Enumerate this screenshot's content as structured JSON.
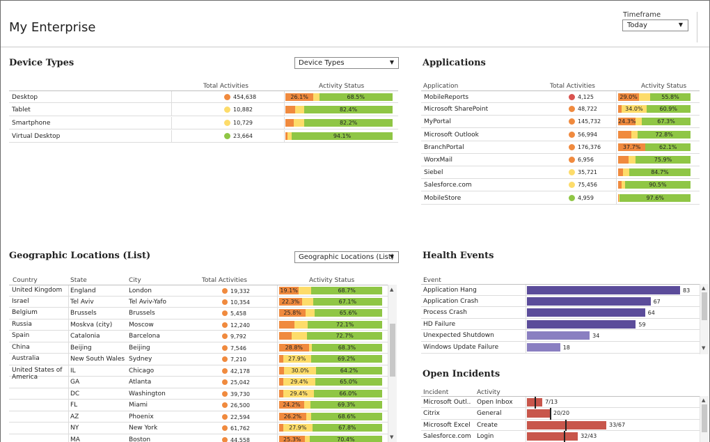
{
  "header": {
    "title": "My Enterprise",
    "timeframe_label": "Timeframe",
    "timeframe_value": "Today"
  },
  "colors": {
    "critical": "#f08a3e",
    "warning": "#fddc6a",
    "ok": "#8fc645",
    "dot_red": "#d9534f",
    "dot_orange": "#f08a3e",
    "dot_yellow": "#fddc6a",
    "dot_green": "#8fc645",
    "health_bar": "#5b4c9a",
    "incident_bar": "#c8564b"
  },
  "device_types": {
    "title": "Device Types",
    "dropdown": "Device Types",
    "col_total": "Total Activities",
    "col_status": "Activity Status",
    "rows": [
      {
        "name": "Desktop",
        "dot": "orange",
        "total": "454,638",
        "r": 26.1,
        "y": 5.4,
        "g": 68.5,
        "rl": "26.1%",
        "gl": "68.5%"
      },
      {
        "name": "Tablet",
        "dot": "yellow",
        "total": "10,882",
        "r": 9,
        "y": 8.6,
        "g": 82.4,
        "rl": "",
        "gl": "82.4%"
      },
      {
        "name": "Smartphone",
        "dot": "yellow",
        "total": "10,729",
        "r": 8,
        "y": 9.8,
        "g": 82.2,
        "rl": "",
        "gl": "82.2%"
      },
      {
        "name": "Virtual Desktop",
        "dot": "green",
        "total": "23,664",
        "r": 2,
        "y": 3.9,
        "g": 94.1,
        "rl": "",
        "gl": "94.1%"
      }
    ]
  },
  "applications": {
    "title": "Applications",
    "col_name": "Application",
    "col_total": "Total Activities",
    "col_status": "Activity Status",
    "rows": [
      {
        "name": "MobileReports",
        "dot": "red",
        "total": "4,125",
        "r": 29.0,
        "y": 15.2,
        "g": 55.8,
        "rl": "29.0%",
        "gl": "55.8%"
      },
      {
        "name": "Microsoft SharePoint",
        "dot": "orange",
        "total": "48,722",
        "r": 5,
        "y": 34.0,
        "g": 60.9,
        "rl": "",
        "yl": "34.0%",
        "gl": "60.9%"
      },
      {
        "name": "MyPortal",
        "dot": "orange",
        "total": "145,732",
        "r": 24.3,
        "y": 8.4,
        "g": 67.3,
        "rl": "24.3%",
        "gl": "67.3%"
      },
      {
        "name": "Microsoft Outlook",
        "dot": "orange",
        "total": "56,994",
        "r": 18,
        "y": 9.2,
        "g": 72.8,
        "rl": "",
        "gl": "72.8%"
      },
      {
        "name": "BranchPortal",
        "dot": "orange",
        "total": "176,376",
        "r": 37.7,
        "y": 0.2,
        "g": 62.1,
        "rl": "37.7%",
        "gl": "62.1%"
      },
      {
        "name": "WorxMail",
        "dot": "orange",
        "total": "6,956",
        "r": 14,
        "y": 10.1,
        "g": 75.9,
        "rl": "",
        "gl": "75.9%"
      },
      {
        "name": "Siebel",
        "dot": "yellow",
        "total": "35,721",
        "r": 7,
        "y": 8.3,
        "g": 84.7,
        "rl": "",
        "gl": "84.7%"
      },
      {
        "name": "Salesforce.com",
        "dot": "yellow",
        "total": "75,456",
        "r": 5,
        "y": 4.5,
        "g": 90.5,
        "rl": "",
        "gl": "90.5%"
      },
      {
        "name": "MobileStore",
        "dot": "green",
        "total": "4,959",
        "r": 1.4,
        "y": 1,
        "g": 97.6,
        "rl": "",
        "gl": "97.6%"
      }
    ]
  },
  "geo": {
    "title": "Geographic Locations (List)",
    "dropdown": "Geographic Locations (List)",
    "col_country": "Country",
    "col_state": "State",
    "col_city": "City",
    "col_total": "Total Activities",
    "col_status": "Activity Status",
    "rows": [
      {
        "country": "United Kingdom",
        "state": "England",
        "city": "London",
        "total": "19,332",
        "r": 19.1,
        "y": 12.2,
        "g": 68.7,
        "rl": "19.1%",
        "gl": "68.7%"
      },
      {
        "country": "Israel",
        "state": "Tel Aviv",
        "city": "Tel Aviv-Yafo",
        "total": "10,354",
        "r": 22.3,
        "y": 10.6,
        "g": 67.1,
        "rl": "22.3%",
        "gl": "67.1%"
      },
      {
        "country": "Belgium",
        "state": "Brussels",
        "city": "Brussels",
        "total": "5,458",
        "r": 25.8,
        "y": 8.6,
        "g": 65.6,
        "rl": "25.8%",
        "gl": "65.6%"
      },
      {
        "country": "Russia",
        "state": "Moskva (city)",
        "city": "Moscow",
        "total": "12,240",
        "r": 15,
        "y": 12.9,
        "g": 72.1,
        "rl": "",
        "gl": "72.1%"
      },
      {
        "country": "Spain",
        "state": "Catalonia",
        "city": "Barcelona",
        "total": "9,792",
        "r": 12,
        "y": 15.3,
        "g": 72.7,
        "rl": "",
        "gl": "72.7%"
      },
      {
        "country": "China",
        "state": "Beijing",
        "city": "Beijing",
        "total": "7,546",
        "r": 28.8,
        "y": 2.9,
        "g": 68.3,
        "rl": "28.8%",
        "gl": "68.3%"
      },
      {
        "country": "Australia",
        "state": "New South Wales",
        "city": "Sydney",
        "total": "7,210",
        "r": 4,
        "y": 26.8,
        "g": 69.2,
        "yl": "27.9%",
        "rl": "",
        "gl": "69.2%"
      },
      {
        "country": "United States of America",
        "state": "IL",
        "city": "Chicago",
        "total": "42,178",
        "r": 5,
        "y": 30.8,
        "g": 64.2,
        "yl": "30.0%",
        "rl": "",
        "gl": "64.2%"
      },
      {
        "country": "",
        "state": "GA",
        "city": "Atlanta",
        "total": "25,042",
        "r": 4,
        "y": 31.0,
        "g": 65.0,
        "yl": "29.4%",
        "rl": "",
        "gl": "65.0%"
      },
      {
        "country": "",
        "state": "DC",
        "city": "Washington",
        "total": "39,730",
        "r": 4,
        "y": 30.0,
        "g": 66.0,
        "yl": "29.4%",
        "rl": "",
        "gl": "66.0%"
      },
      {
        "country": "",
        "state": "FL",
        "city": "Miami",
        "total": "26,500",
        "r": 24.2,
        "y": 6.5,
        "g": 69.3,
        "rl": "24.2%",
        "gl": "69.3%"
      },
      {
        "country": "",
        "state": "AZ",
        "city": "Phoenix",
        "total": "22,594",
        "r": 26.2,
        "y": 5.2,
        "g": 68.6,
        "rl": "26.2%",
        "gl": "68.6%"
      },
      {
        "country": "",
        "state": "NY",
        "city": "New York",
        "total": "61,762",
        "r": 4,
        "y": 28.2,
        "g": 67.8,
        "yl": "27.9%",
        "rl": "",
        "gl": "67.8%"
      },
      {
        "country": "",
        "state": "MA",
        "city": "Boston",
        "total": "44,558",
        "r": 25.3,
        "y": 4.3,
        "g": 70.4,
        "rl": "25.3%",
        "gl": "70.4%"
      }
    ]
  },
  "health": {
    "title": "Health Events",
    "col_event": "Event",
    "max": 83,
    "rows": [
      {
        "name": "Application Hang",
        "value": 83,
        "label": "83",
        "shade": "dark"
      },
      {
        "name": "Application Crash",
        "value": 67,
        "label": "67",
        "shade": "dark"
      },
      {
        "name": "Process Crash",
        "value": 64,
        "label": "64",
        "shade": "dark"
      },
      {
        "name": "HD Failure",
        "value": 59,
        "label": "59",
        "shade": "dark"
      },
      {
        "name": "Unexpected Shutdown",
        "value": 34,
        "label": "34",
        "shade": "light"
      },
      {
        "name": "Windows Update Failure",
        "value": 18,
        "label": "18",
        "shade": "light"
      }
    ]
  },
  "incidents": {
    "title": "Open Incidents",
    "col_incident": "Incident",
    "col_activity": "Activity",
    "max": 67,
    "rows": [
      {
        "name": "Microsoft Outl..",
        "activity": "Open Inbox",
        "value": 13,
        "mark": 7,
        "label": "7/13"
      },
      {
        "name": "Citrix",
        "activity": "General",
        "value": 20,
        "mark": 20,
        "label": "20/20"
      },
      {
        "name": "Microsoft Excel",
        "activity": "Create",
        "value": 67,
        "mark": 33,
        "label": "33/67"
      },
      {
        "name": "Salesforce.com",
        "activity": "Login",
        "value": 43,
        "mark": 32,
        "label": "32/43"
      }
    ]
  }
}
